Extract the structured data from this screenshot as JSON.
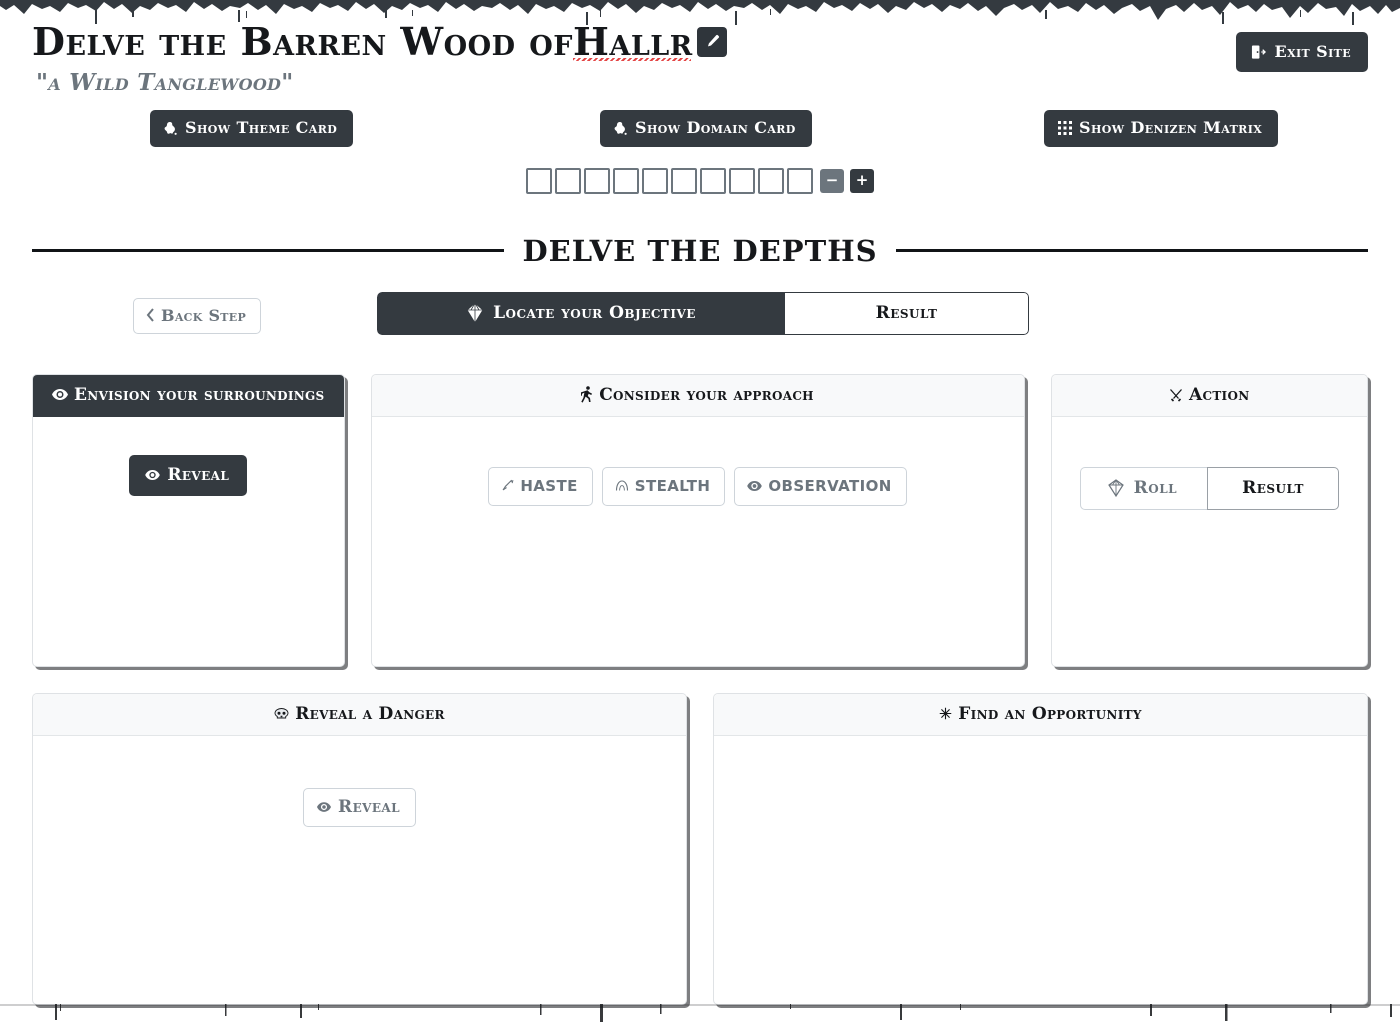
{
  "header": {
    "title_prefix": "Delve the Barren Wood of ",
    "title_name": "Hallr",
    "edit_icon": "pencil-icon",
    "subtitle": "\"a Wild Tanglewood\"",
    "exit_button": {
      "label": "Exit Site",
      "icon": "exit-door-icon"
    }
  },
  "card_buttons": [
    {
      "label": "Show Theme Card",
      "icon": "ink-splat-icon"
    },
    {
      "label": "Show Domain Card",
      "icon": "ink-splat-icon"
    },
    {
      "label": "Show Denizen Matrix",
      "icon": "grid-matrix-icon"
    }
  ],
  "progress": {
    "boxes": 10,
    "filled": 0,
    "decrement_label": "−",
    "increment_label": "+"
  },
  "section": {
    "title": "Delve the Depths",
    "back_step": {
      "label": "Back Step",
      "icon": "chevron-left-icon"
    },
    "tabs": [
      {
        "label": "Locate your Objective",
        "icon": "die-d10-icon",
        "active": true
      },
      {
        "label": "Result",
        "icon": "",
        "active": false
      }
    ]
  },
  "cards": {
    "envision": {
      "title": "Envision your surroundings",
      "icon": "eye-icon",
      "style": "dark",
      "reveal": {
        "label": "Reveal",
        "icon": "eye-icon"
      }
    },
    "approach": {
      "title": "Consider your approach",
      "icon": "running-person-icon",
      "style": "light",
      "options": [
        {
          "label": "Haste",
          "icon": "bolt-icon"
        },
        {
          "label": "Stealth",
          "icon": "hood-icon"
        },
        {
          "label": "Observation",
          "icon": "eye-icon"
        }
      ]
    },
    "action": {
      "title": "Action",
      "icon": "crossed-swords-icon",
      "style": "light",
      "roll": {
        "label": "Roll",
        "icon": "die-d10-icon"
      },
      "result": {
        "label": "Result"
      }
    },
    "danger": {
      "title": "Reveal a Danger",
      "icon": "skull-icon",
      "style": "light",
      "reveal": {
        "label": "Reveal",
        "icon": "eye-icon"
      }
    },
    "opportunity": {
      "title": "Find an Opportunity",
      "icon": "sparkle-icon",
      "style": "light"
    }
  },
  "colors": {
    "dark": "#343a40",
    "muted": "#6c757d",
    "border": "#ced4da",
    "card_head_light": "#f8f9fa",
    "text": "#16181b"
  }
}
